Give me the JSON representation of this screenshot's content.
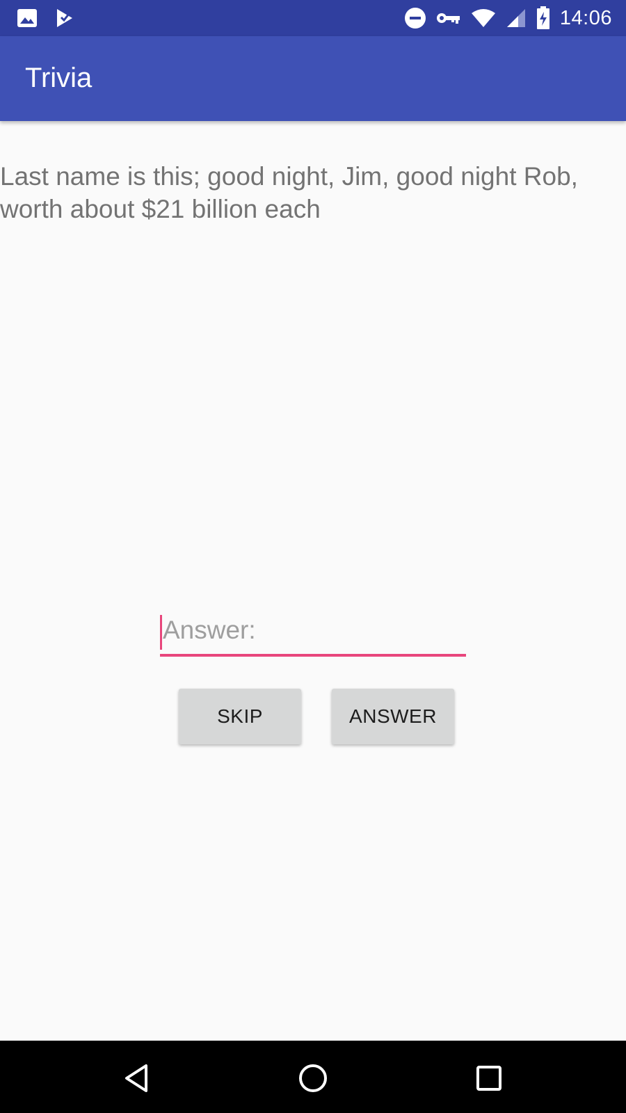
{
  "status_bar": {
    "time": "14:06",
    "left_icons": [
      "image-icon",
      "app-notification-icon"
    ],
    "right_icons": [
      "do-not-disturb-icon",
      "vpn-key-icon",
      "wifi-icon",
      "cell-signal-icon",
      "battery-charging-icon"
    ]
  },
  "app_bar": {
    "title": "Trivia",
    "color": "#3f51b5",
    "status_color": "#303f9f"
  },
  "question": {
    "text": "Last name is this; good night, Jim, good night Rob, worth about $21 billion each"
  },
  "answer_field": {
    "placeholder": "Answer:",
    "value": "",
    "accent_color": "#e8467c"
  },
  "buttons": {
    "skip_label": "SKIP",
    "answer_label": "ANSWER"
  },
  "nav_bar": {
    "icons": [
      "back-icon",
      "home-icon",
      "recents-icon"
    ]
  }
}
